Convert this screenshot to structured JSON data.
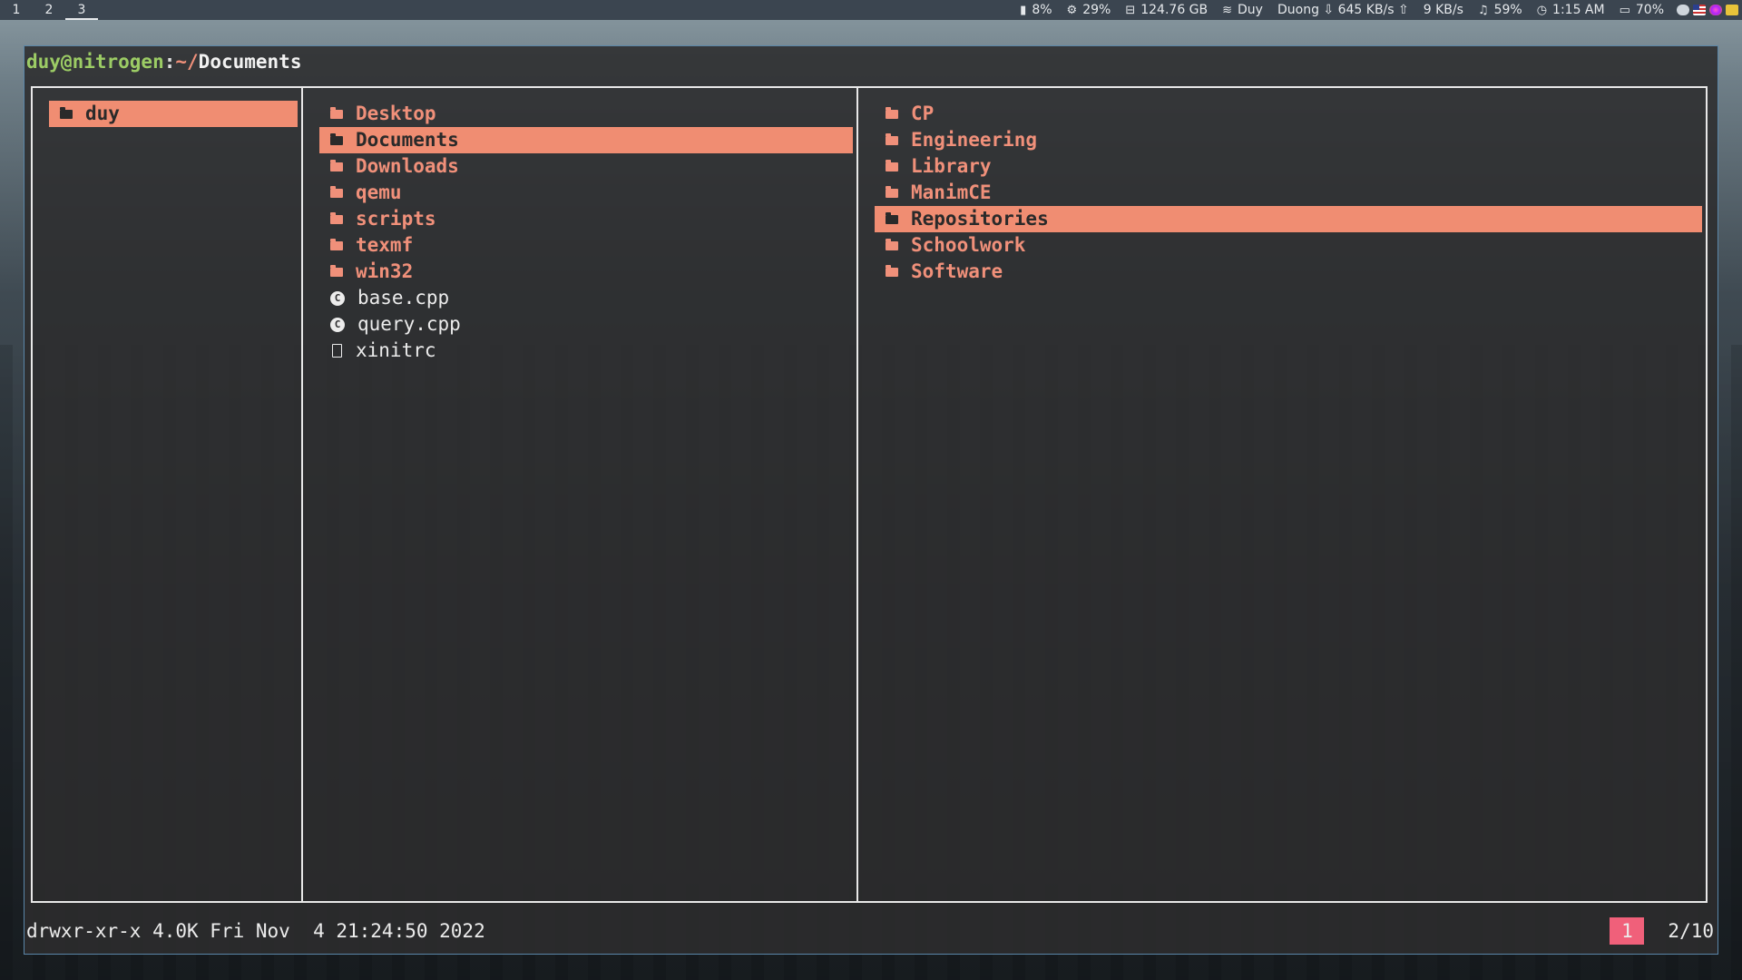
{
  "topbar": {
    "workspaces": [
      "1",
      "2",
      "3"
    ],
    "active_workspace": "3",
    "modules": {
      "memory": "8%",
      "cpu": "29%",
      "disk": "124.76 GB",
      "wifi": "Duy",
      "network": "Duong ⇩ 645 KB/s ⇧",
      "upload": "9 KB/s",
      "volume": "59%",
      "clock": "1:15 AM",
      "battery": "70%"
    },
    "icons": {
      "memory": "memory-icon",
      "cpu": "cpu-icon",
      "disk": "disk-icon",
      "wifi": "wifi-icon",
      "volume": "music-note-icon",
      "clock": "clock-icon",
      "battery": "battery-icon"
    }
  },
  "terminal": {
    "prompt_user": "duy@nitrogen",
    "prompt_colon": ":",
    "prompt_tilde": "~/",
    "prompt_dir": "Documents",
    "parent_column": [
      {
        "name": "duy",
        "type": "folder",
        "selected": true
      }
    ],
    "current_column": [
      {
        "name": "Desktop",
        "type": "folder"
      },
      {
        "name": "Documents",
        "type": "folder",
        "selected": true
      },
      {
        "name": "Downloads",
        "type": "folder"
      },
      {
        "name": "qemu",
        "type": "folder"
      },
      {
        "name": "scripts",
        "type": "folder"
      },
      {
        "name": "texmf",
        "type": "folder"
      },
      {
        "name": "win32",
        "type": "folder"
      },
      {
        "name": "base.cpp",
        "type": "cpp"
      },
      {
        "name": "query.cpp",
        "type": "cpp"
      },
      {
        "name": "xinitrc",
        "type": "file"
      }
    ],
    "preview_column": [
      {
        "name": "CP",
        "type": "folder"
      },
      {
        "name": "Engineering",
        "type": "folder"
      },
      {
        "name": "Library",
        "type": "folder"
      },
      {
        "name": "ManimCE",
        "type": "folder"
      },
      {
        "name": "Repositories",
        "type": "folder",
        "selected": true
      },
      {
        "name": "Schoolwork",
        "type": "folder"
      },
      {
        "name": "Software",
        "type": "folder"
      }
    ],
    "status": {
      "info": "drwxr-xr-x 4.0K Fri Nov  4 21:24:50 2022",
      "tab": "1",
      "position": "2/10"
    }
  },
  "colors": {
    "accent": "#f08d72",
    "folder_text": "#f0907a",
    "prompt_user": "#9ccc65",
    "tab_badge": "#f0607a"
  }
}
